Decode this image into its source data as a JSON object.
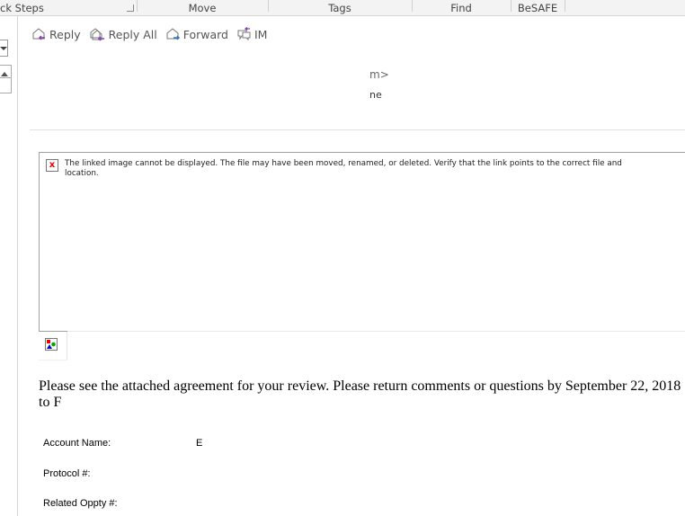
{
  "ribbon": {
    "groups": [
      "ck Steps",
      "Move",
      "Tags",
      "Find",
      "BeSAFE"
    ]
  },
  "actions": {
    "reply": "Reply",
    "reply_all": "Reply All",
    "forward": "Forward",
    "im": "IM"
  },
  "header": {
    "line1": "m>",
    "line2": "ne"
  },
  "linked_image": {
    "message": "The linked image cannot be displayed.  The file may have been moved, renamed, or deleted. Verify that the link points to the correct file and location."
  },
  "body": {
    "text": "Please see the attached agreement for your review. Please return comments or questions by September 22, 2018 to F"
  },
  "fields": [
    {
      "label": "Account Name:",
      "value": "E"
    },
    {
      "label": "Protocol #:",
      "value": ""
    },
    {
      "label": "Related Oppty #:",
      "value": ""
    }
  ]
}
